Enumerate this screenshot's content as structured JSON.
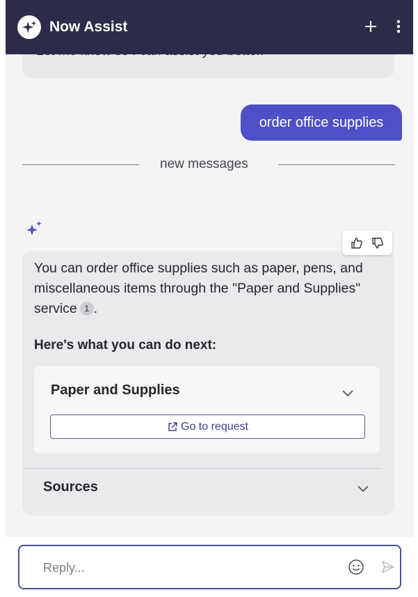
{
  "header": {
    "title": "Now Assist",
    "logo_icon": "now-assist-sparkle-logo",
    "new_chat_icon": "plus-icon",
    "menu_icon": "more-vertical-icon"
  },
  "conversation": {
    "previous_assistant_text": "Let me know so I can assist you better.",
    "user_message": "order office supplies",
    "divider_label": "new messages",
    "assistant": {
      "body_text": "You can order office supplies such as paper, pens, and miscellaneous items through the \"Paper and Supplies\" service",
      "citation_number": "1",
      "body_end": ".",
      "next_heading": "Here's what you can do next:",
      "action": {
        "title": "Paper and Supplies",
        "button_label": "Go to request"
      },
      "sources_label": "Sources"
    }
  },
  "composer": {
    "placeholder": "Reply...",
    "value": ""
  },
  "colors": {
    "header_bg": "#2b2d48",
    "accent": "#4f4fc7",
    "chat_bg": "#f4f4f5",
    "card_bg": "#eaeaec"
  }
}
